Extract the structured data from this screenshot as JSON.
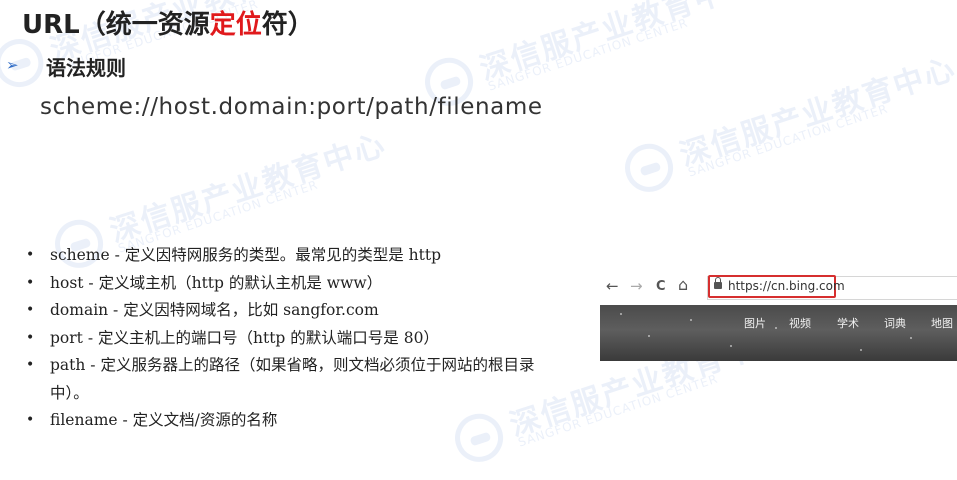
{
  "title": {
    "prefix": "URL（统一资源",
    "highlight": "定位",
    "suffix": "符）"
  },
  "section": {
    "arrow": "➢",
    "heading": "语法规则",
    "syntax": "scheme://host.domain:port/path/filename"
  },
  "items": [
    "scheme - 定义因特网服务的类型。最常见的类型是 http",
    "host - 定义域主机（http 的默认主机是 www）",
    "domain - 定义因特网域名，比如 sangfor.com",
    "port - 定义主机上的端口号（http 的默认端口号是 80）",
    "path - 定义服务器上的路径（如果省略，则文档必须位于网站的根目录中）。",
    "filename - 定义文档/资源的名称"
  ],
  "browser": {
    "back": "←",
    "forward": "→",
    "reload": "C",
    "home": "⌂",
    "url": "https://cn.bing.com",
    "menu": [
      "图片",
      "视频",
      "学术",
      "词典",
      "地图"
    ]
  },
  "watermark": {
    "text": "深信服产业教育中心",
    "subtext": "SANGFOR EDUCATION CENTER"
  },
  "colors": {
    "accent_red": "#e0191c",
    "bullet_arrow": "#2e6bc6",
    "url_highlight": "#d62f2f",
    "watermark": "#2a62c8"
  }
}
